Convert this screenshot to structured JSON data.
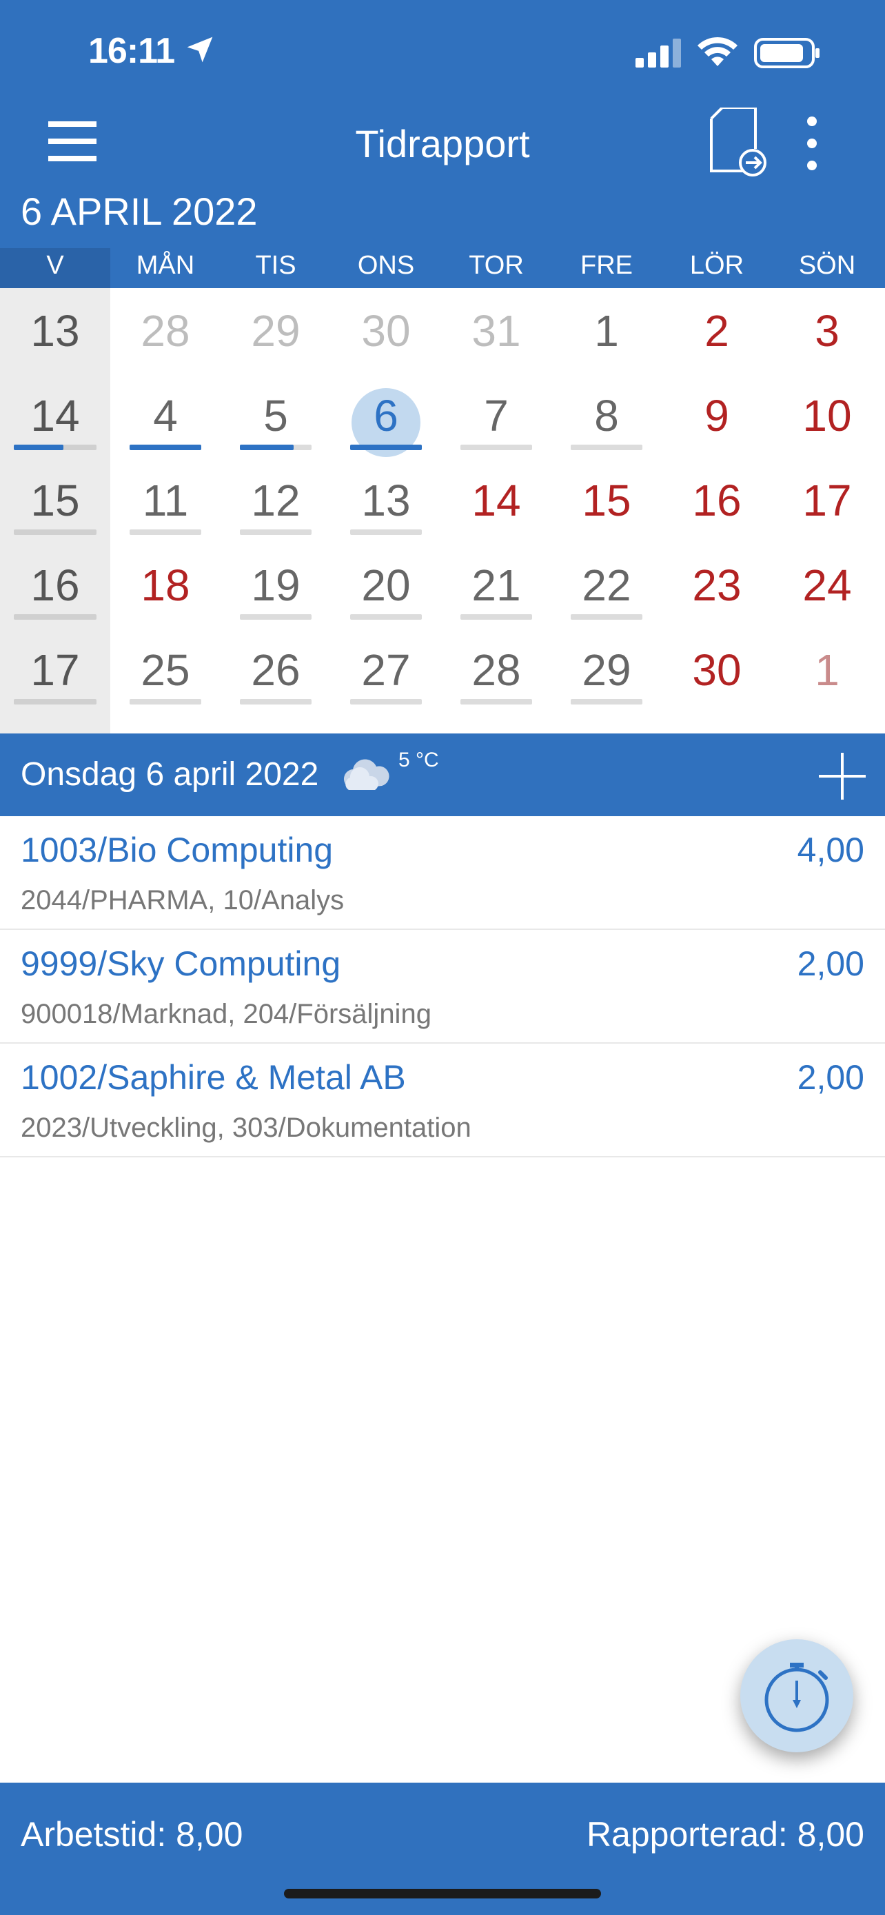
{
  "status_bar": {
    "time": "16:11"
  },
  "nav": {
    "title": "Tidrapport"
  },
  "month_label": "6 APRIL 2022",
  "weekdays": [
    "V",
    "MÅN",
    "TIS",
    "ONS",
    "TOR",
    "FRE",
    "LÖR",
    "SÖN"
  ],
  "weeks": [
    {
      "week": "13",
      "days": [
        {
          "d": "28",
          "style": "muted",
          "progress": null
        },
        {
          "d": "29",
          "style": "muted",
          "progress": null
        },
        {
          "d": "30",
          "style": "muted",
          "progress": null
        },
        {
          "d": "31",
          "style": "muted",
          "progress": null
        },
        {
          "d": "1",
          "style": "normal",
          "progress": null
        },
        {
          "d": "2",
          "style": "red",
          "progress": null
        },
        {
          "d": "3",
          "style": "red",
          "progress": null
        }
      ],
      "week_progress": null
    },
    {
      "week": "14",
      "days": [
        {
          "d": "4",
          "style": "normal",
          "progress": 1.0
        },
        {
          "d": "5",
          "style": "normal",
          "progress": 0.75
        },
        {
          "d": "6",
          "style": "selected",
          "progress": 1.0
        },
        {
          "d": "7",
          "style": "normal",
          "progress": 0
        },
        {
          "d": "8",
          "style": "normal",
          "progress": 0
        },
        {
          "d": "9",
          "style": "red",
          "progress": null
        },
        {
          "d": "10",
          "style": "red",
          "progress": null
        }
      ],
      "week_progress": 0.6
    },
    {
      "week": "15",
      "days": [
        {
          "d": "11",
          "style": "normal",
          "progress": 0
        },
        {
          "d": "12",
          "style": "normal",
          "progress": 0
        },
        {
          "d": "13",
          "style": "normal",
          "progress": 0
        },
        {
          "d": "14",
          "style": "red",
          "progress": null
        },
        {
          "d": "15",
          "style": "red",
          "progress": null
        },
        {
          "d": "16",
          "style": "red",
          "progress": null
        },
        {
          "d": "17",
          "style": "red",
          "progress": null
        }
      ],
      "week_progress": 0
    },
    {
      "week": "16",
      "days": [
        {
          "d": "18",
          "style": "red",
          "progress": null
        },
        {
          "d": "19",
          "style": "normal",
          "progress": 0
        },
        {
          "d": "20",
          "style": "normal",
          "progress": 0
        },
        {
          "d": "21",
          "style": "normal",
          "progress": 0
        },
        {
          "d": "22",
          "style": "normal",
          "progress": 0
        },
        {
          "d": "23",
          "style": "red",
          "progress": null
        },
        {
          "d": "24",
          "style": "red",
          "progress": null
        }
      ],
      "week_progress": 0
    },
    {
      "week": "17",
      "days": [
        {
          "d": "25",
          "style": "normal",
          "progress": 0
        },
        {
          "d": "26",
          "style": "normal",
          "progress": 0
        },
        {
          "d": "27",
          "style": "normal",
          "progress": 0
        },
        {
          "d": "28",
          "style": "normal",
          "progress": 0
        },
        {
          "d": "29",
          "style": "normal",
          "progress": 0
        },
        {
          "d": "30",
          "style": "red",
          "progress": null
        },
        {
          "d": "1",
          "style": "pink",
          "progress": null
        }
      ],
      "week_progress": 0
    }
  ],
  "day_header": {
    "title": "Onsdag 6 april 2022",
    "temperature": "5 °C",
    "weather_icon": "cloud-icon"
  },
  "entries": [
    {
      "project": "1003/Bio Computing",
      "detail": "2044/PHARMA, 10/Analys",
      "hours": "4,00"
    },
    {
      "project": "9999/Sky Computing",
      "detail": "900018/Marknad, 204/Försäljning",
      "hours": "2,00"
    },
    {
      "project": "1002/Saphire & Metal AB",
      "detail": "2023/Utveckling, 303/Dokumentation",
      "hours": "2,00"
    }
  ],
  "footer": {
    "work_time": "Arbetstid: 8,00",
    "reported": "Rapporterad: 8,00"
  },
  "colors": {
    "primary": "#3071be",
    "accent_blue": "#2d72c4",
    "weekend_red": "#b22222",
    "selected_bg": "#c2d9ef"
  }
}
